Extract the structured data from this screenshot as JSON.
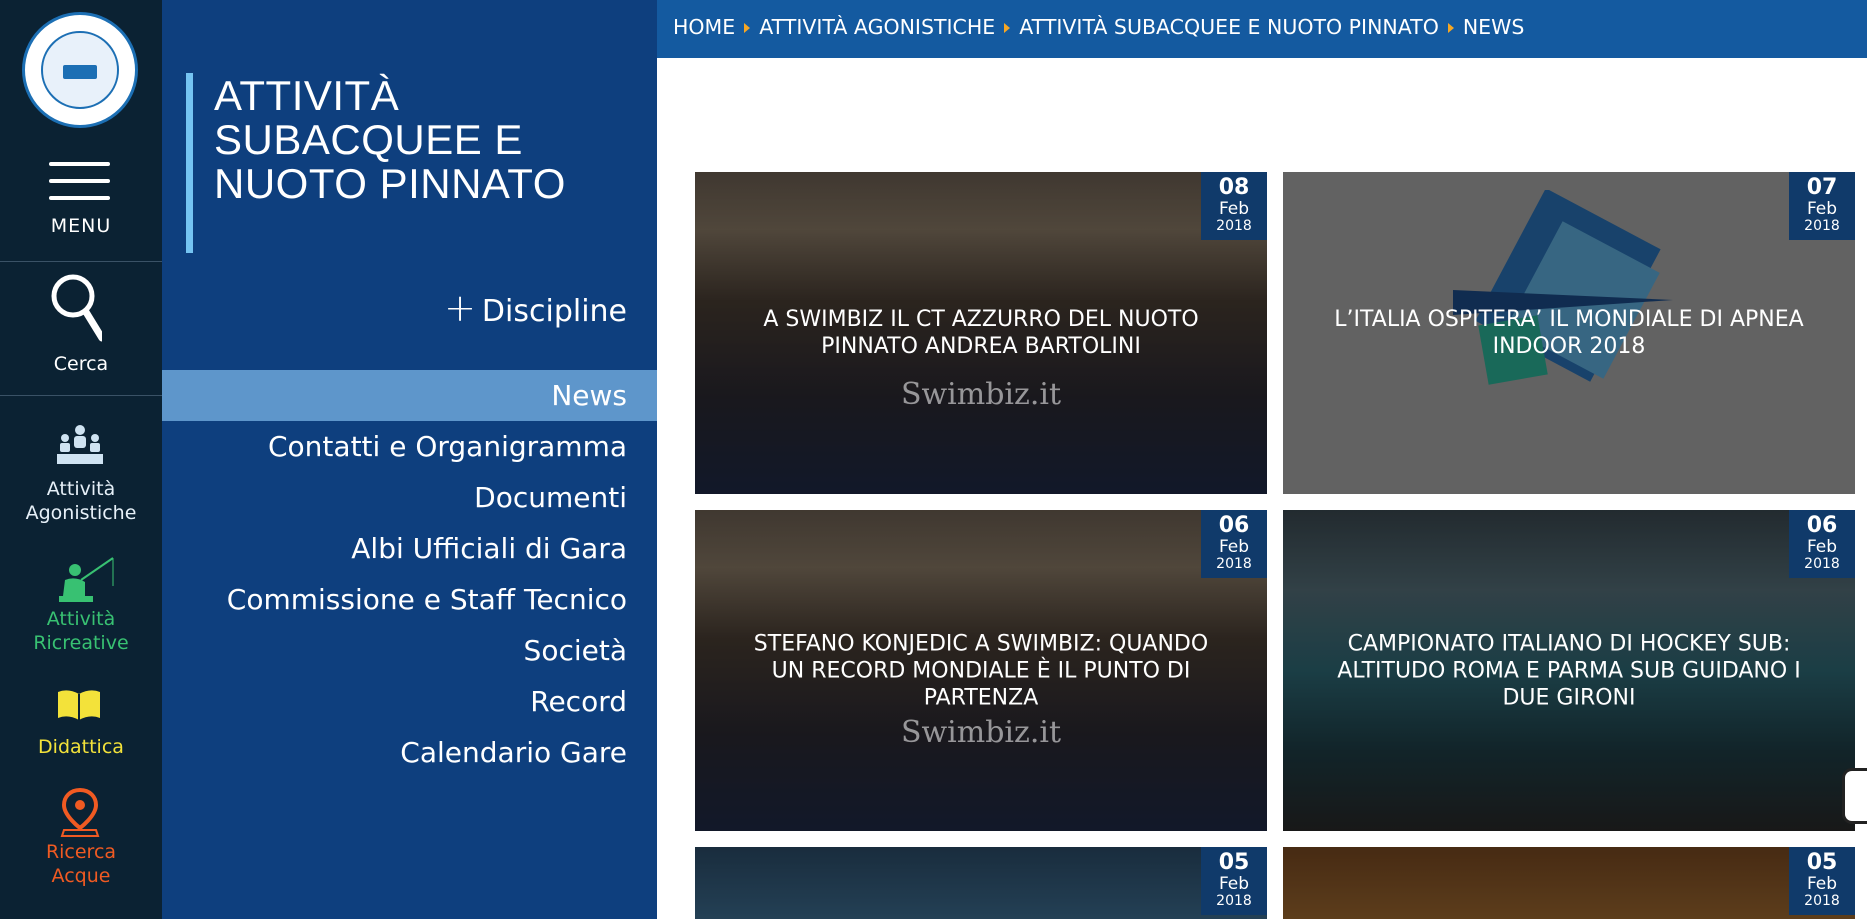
{
  "rail": {
    "menu_label": "MENU",
    "search_label": "Cerca",
    "agonistiche_label_1": "Attività",
    "agonistiche_label_2": "Agonistiche",
    "ricreative_label_1": "Attività",
    "ricreative_label_2": "Ricreative",
    "didattica_label": "Didattica",
    "ricerca_label_1": "Ricerca",
    "ricerca_label_2": "Acque",
    "colors": {
      "agonistiche": "#e6f0f8",
      "ricreative": "#38c172",
      "didattica": "#f3e23a",
      "ricerca": "#f05a22"
    }
  },
  "panel": {
    "title": "ATTIVITÀ SUBACQUEE E NUOTO PINNATO",
    "discipline_label": "Discipline",
    "nav": [
      {
        "label": "News",
        "active": true
      },
      {
        "label": "Contatti e Organigramma",
        "active": false
      },
      {
        "label": "Documenti",
        "active": false
      },
      {
        "label": "Albi Ufficiali di Gara",
        "active": false
      },
      {
        "label": "Commissione e Staff Tecnico",
        "active": false
      },
      {
        "label": "Società",
        "active": false
      },
      {
        "label": "Record",
        "active": false
      },
      {
        "label": "Calendario Gare",
        "active": false
      }
    ]
  },
  "breadcrumb": [
    "HOME",
    "ATTIVITÀ AGONISTICHE",
    "ATTIVITÀ SUBACQUEE E NUOTO PINNATO",
    "NEWS"
  ],
  "news": [
    {
      "headline": "A SWIMBIZ IL CT AZZURRO DEL NUOTO PINNATO ANDREA BARTOLINI",
      "day": "08",
      "month": "Feb",
      "year": "2018",
      "watermark": "Swimbiz.it"
    },
    {
      "headline": "L’ITALIA OSPITERA’ IL MONDIALE DI APNEA INDOOR 2018",
      "day": "07",
      "month": "Feb",
      "year": "2018",
      "watermark": ""
    },
    {
      "headline": "STEFANO KONJEDIC A SWIMBIZ: QUANDO UN RECORD MONDIALE È IL PUNTO DI PARTENZA",
      "day": "06",
      "month": "Feb",
      "year": "2018",
      "watermark": "Swimbiz.it"
    },
    {
      "headline": "CAMPIONATO ITALIANO DI HOCKEY SUB: ALTITUDO ROMA E PARMA SUB GUIDANO I DUE GIRONI",
      "day": "06",
      "month": "Feb",
      "year": "2018",
      "watermark": ""
    },
    {
      "headline": "",
      "day": "05",
      "month": "Feb",
      "year": "2018",
      "watermark": ""
    },
    {
      "headline": "",
      "day": "05",
      "month": "Feb",
      "year": "2018",
      "watermark": ""
    }
  ]
}
